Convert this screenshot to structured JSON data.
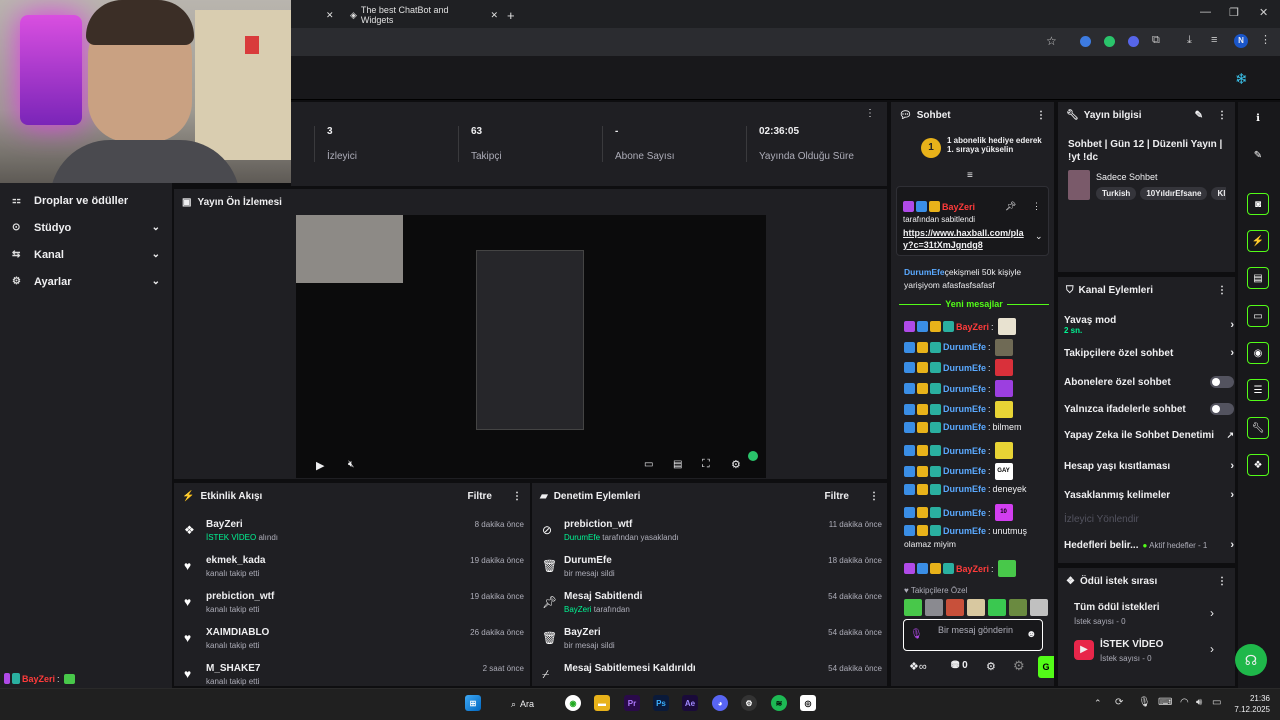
{
  "browser": {
    "tab_title": "The best ChatBot and Widgets",
    "new_tab": "+",
    "window": {
      "minimize": "—",
      "restore": "❐",
      "close": "✕"
    },
    "profile_initial": "N"
  },
  "sidebar": {
    "items": [
      {
        "label": "Droplar ve ödüller",
        "icon": "gift-icon"
      },
      {
        "label": "Stüdyo",
        "icon": "studio-icon"
      },
      {
        "label": "Kanal",
        "icon": "channel-icon"
      },
      {
        "label": "Ayarlar",
        "icon": "gear-icon"
      }
    ]
  },
  "stats": [
    {
      "value": "3",
      "label": "İzleyici"
    },
    {
      "value": "63",
      "label": "Takipçi"
    },
    {
      "value": "-",
      "label": "Abone Sayısı"
    },
    {
      "value": "02:36:05",
      "label": "Yayında Olduğu Süre"
    }
  ],
  "preview": {
    "title": "Yayın Ön İzlemesi"
  },
  "activity": {
    "title": "Etkinlik Akışı",
    "filter": "Filtre",
    "items": [
      {
        "name": "BayZeri",
        "sub_highlight": "İSTEK VİDEO",
        "sub": " alındı",
        "time": "8 dakika önce",
        "icon": "reward-icon"
      },
      {
        "name": "ekmek_kada",
        "sub_highlight": "",
        "sub": "kanalı takip etti",
        "time": "19 dakika önce",
        "icon": "heart-icon"
      },
      {
        "name": "prebiction_wtf",
        "sub_highlight": "",
        "sub": "kanalı takip etti",
        "time": "19 dakika önce",
        "icon": "heart-icon"
      },
      {
        "name": "XAIMDIABLO",
        "sub_highlight": "",
        "sub": "kanalı takip etti",
        "time": "26 dakika önce",
        "icon": "heart-icon"
      },
      {
        "name": "M_SHAKE7",
        "sub_highlight": "",
        "sub": "kanalı takip etti",
        "time": "2 saat önce",
        "icon": "heart-icon"
      }
    ]
  },
  "moderation": {
    "title": "Denetim Eylemleri",
    "filter": "Filtre",
    "items": [
      {
        "name": "prebiction_wtf",
        "sub_highlight": "DurumEfe",
        "sub": " tarafından yasaklandı",
        "time": "11 dakika önce",
        "icon": "ban-icon"
      },
      {
        "name": "DurumEfe",
        "sub_highlight": "",
        "sub": "bir mesajı sildi",
        "time": "18 dakika önce",
        "icon": "trash-icon"
      },
      {
        "name": "Mesaj Sabitlendi",
        "sub_highlight": "BayZeri",
        "sub": " tarafından",
        "time": "54 dakika önce",
        "icon": "pin-icon"
      },
      {
        "name": "BayZeri",
        "sub_highlight": "",
        "sub": "bir mesajı sildi",
        "time": "54 dakika önce",
        "icon": "trash-icon"
      },
      {
        "name": "Mesaj Sabitlemesi Kaldırıldı",
        "sub_highlight": "",
        "sub": "",
        "time": "54 dakika önce",
        "icon": "unpin-icon"
      }
    ]
  },
  "chat": {
    "title": "Sohbet",
    "gift_text": "1 abonelik hediye ederek 1. sıraya yükselin",
    "gift_count": "1",
    "pinned_user": "BayZeri",
    "pinned_by": "tarafından sabitlendi",
    "pinned_link": "https://www.haxball.com/play?c=31tXmJgndg8",
    "older_user": "DurumEfe",
    "older_text": "çekişmeli 50k kişiyle yarişiyom afasfasfsafasf",
    "new_messages": "Yeni mesajlar",
    "messages": [
      {
        "user": "BayZeri",
        "text": "",
        "emote": "#e8e2d0"
      },
      {
        "user": "DurumEfe",
        "text": "",
        "emote": "#6f6a55"
      },
      {
        "user": "DurumEfe",
        "text": "",
        "emote": "#d9303a"
      },
      {
        "user": "DurumEfe",
        "text": "",
        "emote": "#9c3fe0"
      },
      {
        "user": "DurumEfe",
        "text": "",
        "emote": "#e8d435"
      },
      {
        "user": "DurumEfe",
        "text": "bilmem",
        "emote": ""
      },
      {
        "user": "DurumEfe",
        "text": "",
        "emote": "#e8d435"
      },
      {
        "user": "DurumEfe",
        "text": "",
        "emote": "#ffffff",
        "emote_text": "GAY"
      },
      {
        "user": "DurumEfe",
        "text": "deneyek",
        "emote": ""
      },
      {
        "user": "DurumEfe",
        "text": "",
        "emote": "#d23ef0",
        "emote_text": "10"
      },
      {
        "user": "DurumEfe",
        "text": "unutmuş",
        "emote": ""
      }
    ],
    "wrap_line": "olamaz miyim",
    "last_user": "BayZeri",
    "followers_only": "Takipçilere Özel",
    "input_placeholder": "Bir mesaj gönderin",
    "points": "0",
    "send": "G"
  },
  "stream_info": {
    "title": "Yayın bilgisi",
    "stream_title": "Sohbet | Gün 12 | Düzenli Yayın | !yt !dc",
    "category": "Sadece Sohbet",
    "tags": [
      "Turkish",
      "10YıldırEfsane",
      "Kl"
    ]
  },
  "channel_actions": {
    "title": "Kanal Eylemleri",
    "slow_mode": "Yavaş mod",
    "slow_mode_value": "2 sn.",
    "followers_only": "Takipçilere özel sohbet",
    "subscribers_only": "Abonelere özel sohbet",
    "emotes_only": "Yalnızca ifadelerle sohbet",
    "ai_moderation": "Yapay Zeka ile Sohbet Denetimi",
    "account_age": "Hesap yaşı kısıtlaması",
    "banned_words": "Yasaklanmış kelimeler",
    "redirect": "İzleyici Yönlendir",
    "goals": "Hedefleri belir...",
    "goals_sub": "Aktif hedefler - 1"
  },
  "rewards": {
    "title": "Ödül istek sırası",
    "all_label": "Tüm ödül istekleri",
    "all_count": "İstek sayısı - 0",
    "video_label": "İSTEK VİDEO",
    "video_count": "İstek sayısı - 0"
  },
  "overlay": {
    "user": "BayZeri",
    "sep": ":"
  },
  "taskbar": {
    "search": "Ara",
    "time": "21:36",
    "date": "7.12.2025"
  },
  "colors": {
    "accent": "#00f593",
    "brand": "#53fc18",
    "red": "#ff3b3b",
    "blue": "#5aa9ff"
  }
}
